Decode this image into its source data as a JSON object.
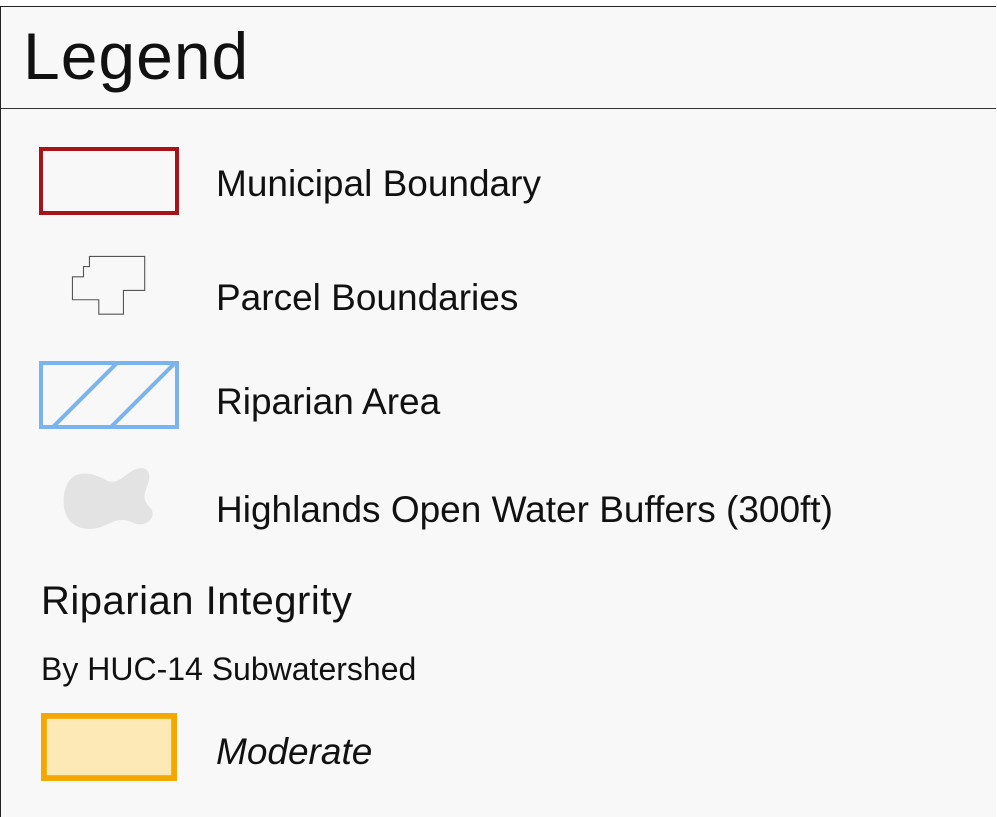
{
  "legend": {
    "title": "Legend",
    "items": [
      {
        "label": "Municipal Boundary",
        "icon": "red-outline-rectangle",
        "stroke": "#a6141a"
      },
      {
        "label": "Parcel Boundaries",
        "icon": "parcel-outline-polygon",
        "stroke": "#555555"
      },
      {
        "label": "Riparian Area",
        "icon": "blue-hatched-rectangle",
        "stroke": "#7ab4ef"
      },
      {
        "label": "Highlands Open Water Buffers (300ft)",
        "icon": "gray-blob",
        "fill": "#e3e3e3"
      }
    ],
    "integrity": {
      "title": "Riparian Integrity",
      "subtitle": "By HUC-14 Subwatershed",
      "classes": [
        {
          "label": "Moderate",
          "fill": "#fde9b6",
          "stroke": "#f2a800"
        }
      ]
    }
  }
}
